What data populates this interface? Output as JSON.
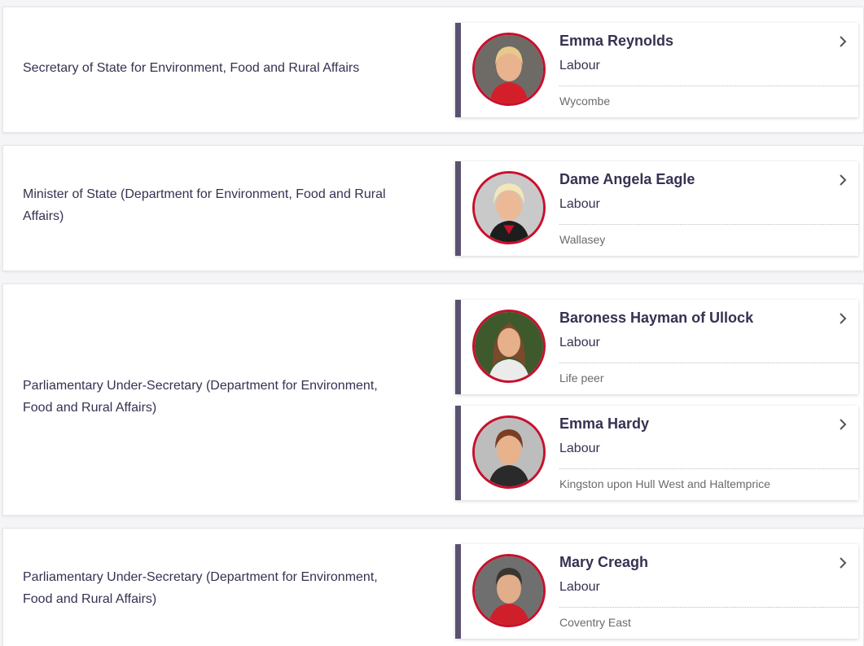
{
  "roles": [
    {
      "title": "Secretary of State for Environment, Food and Rural Affairs",
      "members": [
        {
          "name": "Emma Reynolds",
          "party": "Labour",
          "constituency": "Wycombe"
        }
      ]
    },
    {
      "title": "Minister of State (Department for Environment, Food and Rural Affairs)",
      "members": [
        {
          "name": "Dame Angela Eagle",
          "party": "Labour",
          "constituency": "Wallasey"
        }
      ]
    },
    {
      "title": "Parliamentary Under-Secretary (Department for Environment, Food and Rural Affairs)",
      "members": [
        {
          "name": "Baroness Hayman of Ullock",
          "party": "Labour",
          "constituency": "Life peer"
        },
        {
          "name": "Emma Hardy",
          "party": "Labour",
          "constituency": "Kingston upon Hull West and Haltemprice"
        }
      ]
    },
    {
      "title": "Parliamentary Under-Secretary (Department for Environment, Food and Rural Affairs)",
      "members": [
        {
          "name": "Mary Creagh",
          "party": "Labour",
          "constituency": "Coventry East"
        }
      ]
    }
  ],
  "icons": {
    "chevron": "chevron-right-icon",
    "avatar": "member-portrait"
  },
  "colors": {
    "party_accent": "#5b5270",
    "avatar_ring": "#c8102e",
    "text": "#373151",
    "muted": "#6b6b6b"
  }
}
